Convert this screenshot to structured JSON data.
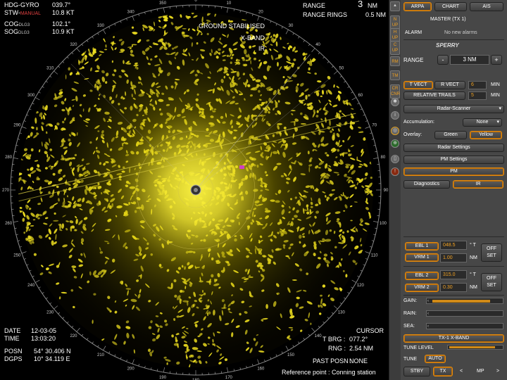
{
  "overlay": {
    "hdg_label": "HDG-GYRO",
    "hdg_value": "039.7°",
    "stw_label": "STW-",
    "stw_mode": "MANUAL",
    "stw_value": "10.8 KT",
    "cog_label": "COG",
    "cog_sub": "DLG3",
    "cog_value": "102.1°",
    "sog_label": "SOG",
    "sog_sub": "DLG3",
    "sog_value": "10.9 KT",
    "range_label": "RANGE",
    "range_value": "3",
    "range_unit": "NM",
    "rings_label": "RANGE RINGS",
    "rings_value": "0.5 NM",
    "stab": "GROUND STABILISED",
    "band": "X-BAND",
    "mode": "IR",
    "date_label": "DATE",
    "date_value": "12-03-05",
    "time_label": "TIME",
    "time_value": "13:03:20",
    "posn_label": "POSN",
    "posn_value": "54° 30.406 N",
    "dgps_label": "DGPS",
    "dgps_value": "10° 34.119 E",
    "cursor_label": "CURSOR",
    "tbrg_label": "T BRG :",
    "tbrg_value": "077.2°",
    "rng_label": "RNG :",
    "rng_value": "2.54 NM",
    "past_label": "PAST POSN :",
    "past_value": "NONE",
    "ref_point": "Reference point : Conning station"
  },
  "bearing_labels": [
    "0",
    "10",
    "20",
    "30",
    "40",
    "50",
    "60",
    "70",
    "80",
    "90",
    "100",
    "110",
    "120",
    "130",
    "140",
    "150",
    "160",
    "170",
    "180",
    "190",
    "200",
    "210",
    "220",
    "230",
    "240",
    "250",
    "260",
    "270",
    "280",
    "290",
    "300",
    "310",
    "320",
    "330",
    "340",
    "350"
  ],
  "strip": {
    "items": [
      {
        "label": "N UP",
        "icon": "north-up-icon"
      },
      {
        "label": "H UP",
        "icon": "head-up-icon"
      },
      {
        "label": "C UP",
        "icon": "course-up-icon"
      },
      {
        "label": "RM",
        "icon": "relative-motion-icon"
      },
      {
        "label": "TM",
        "icon": "true-motion-icon"
      },
      {
        "label": "CR CNR",
        "icon": "center-icon"
      }
    ]
  },
  "panel": {
    "tab_arpa": "ARPA",
    "tab_chart": "CHART",
    "tab_ais": "AIS",
    "master": "MASTER (TX 1)",
    "alarm_label": "ALARM",
    "alarm_value": "No new alarms",
    "brand": "SPERRY",
    "range_label": "RANGE",
    "range_minus": "-",
    "range_value": "3 NM",
    "range_plus": "+",
    "tvect": "T VECT",
    "rvect": "R VECT",
    "vect_value": "6",
    "vect_unit": "MIN",
    "trails": "RELATIVE TRAILS",
    "trails_value": "5",
    "trails_unit": "MIN",
    "scanner": "Radar-Scanner",
    "accum_label": "Accumulation:",
    "accum_value": "None",
    "overlay_label": "Overlay:",
    "overlay_green": "Green",
    "overlay_yellow": "Yellow",
    "radar_settings": "Radar Settings",
    "pm_settings": "PM Settings",
    "pm": "PM",
    "diagnostics": "Diagnostics",
    "ir": "IR",
    "ebl1": "EBL 1",
    "ebl1_value": "048.5",
    "ebl1_unit": "° T",
    "vrm1": "VRM 1",
    "vrm1_value": "1.00",
    "vrm1_unit": "NM",
    "offset1": "OFF SET",
    "ebl2": "EBL 2",
    "ebl2_value": "315.0",
    "ebl2_unit": "° T",
    "vrm2": "VRM 2",
    "vrm2_value": "0.30",
    "vrm2_unit": "NM",
    "offset2": "OFF SET",
    "gain_label": "GAIN:",
    "gain_level": 0.82,
    "rain_label": "RAIN:",
    "rain_level": 0.0,
    "sea_label": "SEA:",
    "sea_level": 0.0,
    "tx_band": "TX-1  X-BAND",
    "tune_level_label": "TUNE LEVEL",
    "tune_level": 0.85,
    "tune_label": "TUNE",
    "tune_mode": "AUTO",
    "stby": "STBY",
    "tx": "TX",
    "arrow_left": "<",
    "mp": "MP",
    "arrow_right": ">"
  },
  "colors": {
    "echo": "#f0e020",
    "accent": "#e08a10",
    "panel": "#474747"
  }
}
